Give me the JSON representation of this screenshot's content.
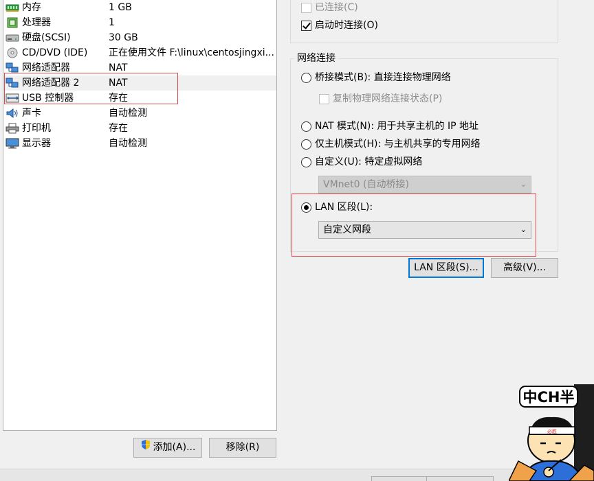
{
  "devices": [
    {
      "name": "内存",
      "summary": "1 GB",
      "icon": "memory-icon"
    },
    {
      "name": "处理器",
      "summary": "1",
      "icon": "processor-icon"
    },
    {
      "name": "硬盘(SCSI)",
      "summary": "30 GB",
      "icon": "hard-disk-icon"
    },
    {
      "name": "CD/DVD (IDE)",
      "summary": "正在使用文件 F:\\linux\\centosjingxi...",
      "icon": "cd-dvd-icon"
    },
    {
      "name": "网络适配器",
      "summary": "NAT",
      "icon": "network-adapter-icon"
    },
    {
      "name": "网络适配器 2",
      "summary": "NAT",
      "icon": "network-adapter-icon"
    },
    {
      "name": "USB 控制器",
      "summary": "存在",
      "icon": "usb-icon"
    },
    {
      "name": "声卡",
      "summary": "自动检测",
      "icon": "sound-card-icon"
    },
    {
      "name": "打印机",
      "summary": "存在",
      "icon": "printer-icon"
    },
    {
      "name": "显示器",
      "summary": "自动检测",
      "icon": "display-icon"
    }
  ],
  "buttons": {
    "add": "添加(A)...",
    "remove": "移除(R)",
    "lan_segments": "LAN 区段(S)...",
    "advanced": "高级(V)..."
  },
  "device_status": {
    "connected": "已连接(C)",
    "connect_at_power_on": "启动时连接(O)"
  },
  "network": {
    "group_label": "网络连接",
    "bridged": "桥接模式(B): 直接连接物理网络",
    "replicate": "复制物理网络连接状态(P)",
    "nat": "NAT 模式(N): 用于共享主机的 IP 地址",
    "host_only": "仅主机模式(H): 与主机共享的专用网络",
    "custom": "自定义(U): 特定虚拟网络",
    "custom_value": "VMnet0 (自动桥接)",
    "lan_segment": "LAN 区段(L):",
    "lan_value": "自定义网段"
  },
  "sticker": {
    "text": "中CH半",
    "headband": "必胜"
  },
  "colors": {
    "highlight_box": "#e0474c",
    "focus_blue": "#0078d7"
  }
}
